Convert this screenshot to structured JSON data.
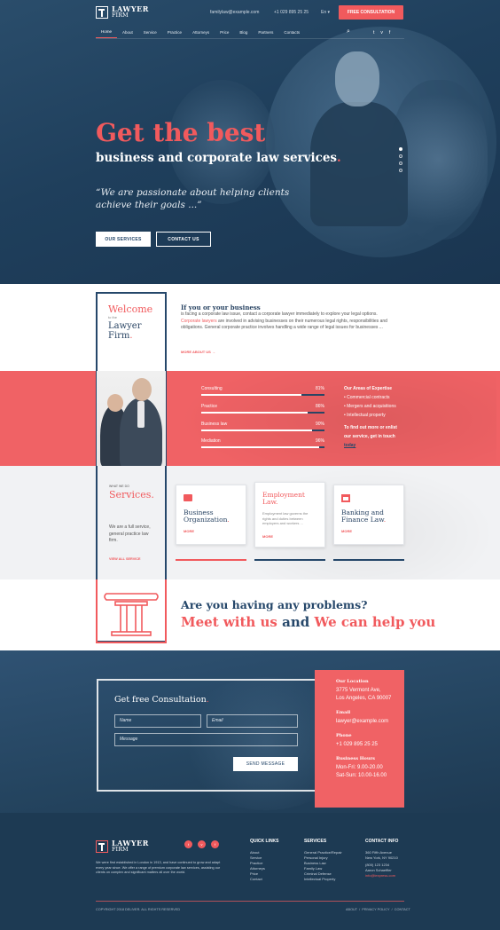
{
  "header": {
    "logo_line1": "LAWYER",
    "logo_line2": "FIRM",
    "email": "familylaw@example.com",
    "phone": "+1 029 895 25 25",
    "lang": "En ▾",
    "cta": "FREE CONSULTATION"
  },
  "nav": {
    "items": [
      "Home",
      "About",
      "Service",
      "Practice",
      "Attorneys",
      "Price",
      "Blog",
      "Partners",
      "Contacts"
    ],
    "search_icon": "⌕",
    "social": [
      "t",
      "v",
      "f"
    ]
  },
  "hero": {
    "title": "Get the best",
    "subtitle": "business and corporate law services",
    "subtitle_dot": ".",
    "quote": "“We are passionate about helping clients achieve their goals ...”",
    "btn1": "OUR SERVICES",
    "btn2": "CONTACT US"
  },
  "welcome": {
    "title": "Welcome",
    "to": "to the",
    "name1": "Lawyer",
    "name2": "Firm",
    "dot": ".",
    "heading": "If you or your business",
    "p1": "is facing a corporate law issue, contact a corporate lawyer immediately to explore your legal options.",
    "p_link": "Corporate lawyers",
    "p2": "are involved in advising businesses on their numerous legal rights, responsibilities and obligations. General corporate practice involves handling a wide range of legal issues for businesses ...",
    "more": "MORE ABOUT US"
  },
  "skills": [
    {
      "label": "Consulting",
      "value": 81,
      "text": "81%"
    },
    {
      "label": "Practice",
      "value": 86,
      "text": "86%"
    },
    {
      "label": "Business law",
      "value": 90,
      "text": "90%"
    },
    {
      "label": "Mediation",
      "value": 96,
      "text": "96%"
    }
  ],
  "areas": {
    "title": "Our Areas of Expertise",
    "items": [
      "Commercial contracts",
      "Mergers and acquisitions",
      "Intellectual property"
    ],
    "cta1": "To find out more or enlist",
    "cta2": "our service, get in touch",
    "cta3": "today"
  },
  "services": {
    "what": "WHAT WE DO",
    "title": "Services",
    "desc": "We are a full service, general practice law firm.",
    "view_all": "VIEW ALL SERVICE",
    "cards": [
      {
        "title1": "Business",
        "title2": "Organization",
        "more": "MORE"
      },
      {
        "title1": "Employment",
        "title2": "Law",
        "desc": "Employment law governs the rights and duties between employers and workers ...",
        "more": "MORE"
      },
      {
        "title1": "Banking and",
        "title2": "Finance Law",
        "more": "MORE"
      }
    ]
  },
  "problems": {
    "line1": "Are you having any problems?",
    "part1": "Meet with us",
    "part2": "and",
    "part3": "We can help you"
  },
  "consult": {
    "title": "Get free Consultation",
    "name_ph": "Name",
    "email_ph": "Email",
    "message_ph": "Message",
    "send": "SEND MESSAGE"
  },
  "contact": {
    "loc_label": "Our Location",
    "loc1": "3775 Vermont Ave,",
    "loc2": "Los Angeles, CA 90007",
    "email_label": "Email",
    "email": "lawyer@example.com",
    "phone_label": "Phone",
    "phone": "+1 029 895 25 25",
    "hours_label": "Business Hours",
    "hours1": "Mon-Fri: 9.00-20.00",
    "hours2": "Sat-Sun: 10.00-16.00"
  },
  "footer": {
    "logo1": "LAWYER",
    "logo2": "FIRM",
    "about": "We were first established in London in 1913, and have continued to grow and adapt every year since. We offer a range of premium corporate law services, assisting our clients on complex and significant matters all over the world.",
    "quick_title": "QUICK LINKS",
    "quick": [
      "About",
      "Service",
      "Practice",
      "Attorneys",
      "Price",
      "Contact"
    ],
    "services_title": "SERVICES",
    "services": [
      "General Practice/Repair",
      "Personal Injury",
      "Business Law",
      "Family Law",
      "Criminal Defense",
      "Intellectual Property"
    ],
    "contact_title": "CONTACT INFO",
    "contact": [
      "360 Fifth Avenue",
      "New York, NY 90210",
      "(800) 123 1234",
      "Aaron Schaeffler",
      "info@lexpress.com"
    ],
    "copyright": "COPYRIGHT 2018 DELIVER. ALL RIGHTS RESERVED",
    "links": "ABOUT  /  PRIVACY POLICY  /  CONTACT"
  },
  "colors": {
    "accent": "#f15a5d",
    "navy": "#25476a"
  }
}
